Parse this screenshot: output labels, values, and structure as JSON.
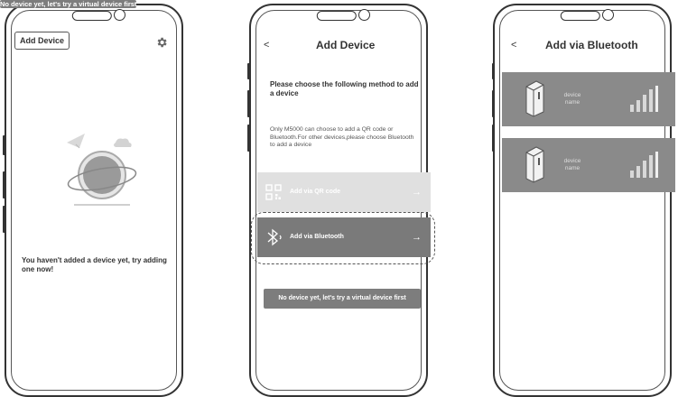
{
  "screen1": {
    "add_device_label": "Add Device",
    "settings_icon": "gear-icon",
    "empty_message": "You haven't added a device yet, try adding one now!",
    "virtual_button": "No device yet, let's try a virtual device first"
  },
  "screen2": {
    "back": "<",
    "title": "Add Device",
    "choose_text": "Please choose the following method to add a device",
    "note": "Only M5000 can choose to add a QR code or Bluetooth.For other devices,please choose Bluetooth to add a device",
    "methods": [
      {
        "label": "Add via QR code",
        "icon": "qr-code-icon",
        "arrow": "→"
      },
      {
        "label": "Add via Bluetooth",
        "icon": "bluetooth-icon",
        "arrow": "→"
      }
    ],
    "virtual_button": "No device yet, let's try a virtual device first"
  },
  "screen3": {
    "back": "<",
    "title": "Add via Bluetooth",
    "devices": [
      {
        "name": "device name",
        "icon": "device-icon"
      },
      {
        "name": "device name",
        "icon": "device-icon"
      }
    ]
  },
  "colors": {
    "button_grey": "#7d7d7d",
    "disabled_grey": "#e0e0e0",
    "card_grey": "#8a8a8a"
  }
}
